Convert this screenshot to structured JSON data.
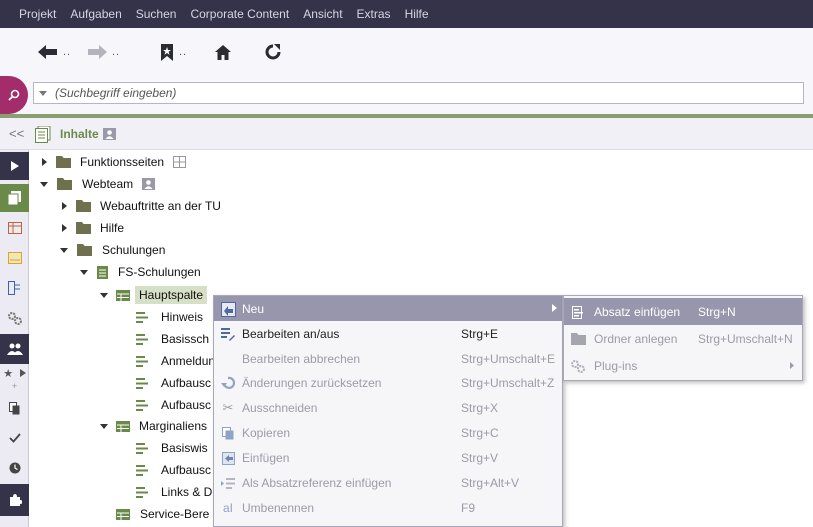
{
  "menubar": [
    "Projekt",
    "Aufgaben",
    "Suchen",
    "Corporate Content",
    "Ansicht",
    "Extras",
    "Hilfe"
  ],
  "toolbar": {
    "back_dots": "..",
    "forward_dots": "..",
    "bookmark_dots": ".."
  },
  "search": {
    "placeholder": "(Suchbegriff eingeben)"
  },
  "section": {
    "title": "Inhalte",
    "collapse": "<<"
  },
  "tree": [
    {
      "label": "Funktionsseiten"
    },
    {
      "label": "Webteam"
    },
    {
      "label": "Webauftritte an der TU"
    },
    {
      "label": "Hilfe"
    },
    {
      "label": "Schulungen"
    },
    {
      "label": "FS-Schulungen"
    },
    {
      "label": "Hauptspalte"
    },
    {
      "label": "Hinweis"
    },
    {
      "label": "Basissch"
    },
    {
      "label": "Anmeldun"
    },
    {
      "label": "Aufbausc"
    },
    {
      "label": "Aufbausc"
    },
    {
      "label": "Marginaliens"
    },
    {
      "label": "Basiswis"
    },
    {
      "label": "Aufbausc"
    },
    {
      "label": "Links & D"
    },
    {
      "label": "Service-Bere"
    }
  ],
  "context_menu": [
    {
      "label": "Neu",
      "shortcut": ""
    },
    {
      "label": "Bearbeiten an/aus",
      "shortcut": "Strg+E"
    },
    {
      "label": "Bearbeiten abbrechen",
      "shortcut": "Strg+Umschalt+E"
    },
    {
      "label": "Änderungen zurücksetzen",
      "shortcut": "Strg+Umschalt+Z"
    },
    {
      "label": "Ausschneiden",
      "shortcut": "Strg+X"
    },
    {
      "label": "Kopieren",
      "shortcut": "Strg+C"
    },
    {
      "label": "Einfügen",
      "shortcut": "Strg+V"
    },
    {
      "label": "Als Absatzreferenz einfügen",
      "shortcut": "Strg+Alt+V"
    },
    {
      "label": "Umbenennen",
      "shortcut": "F9"
    }
  ],
  "submenu": [
    {
      "label": "Absatz einfügen",
      "shortcut": "Strg+N"
    },
    {
      "label": "Ordner anlegen",
      "shortcut": "Strg+Umschalt+N"
    },
    {
      "label": "Plug-ins",
      "shortcut": ""
    }
  ],
  "colors": {
    "menubar": "#34334a",
    "accent_green": "#8a9f70",
    "search_button": "#a32c6a",
    "highlight": "#9896ac"
  }
}
